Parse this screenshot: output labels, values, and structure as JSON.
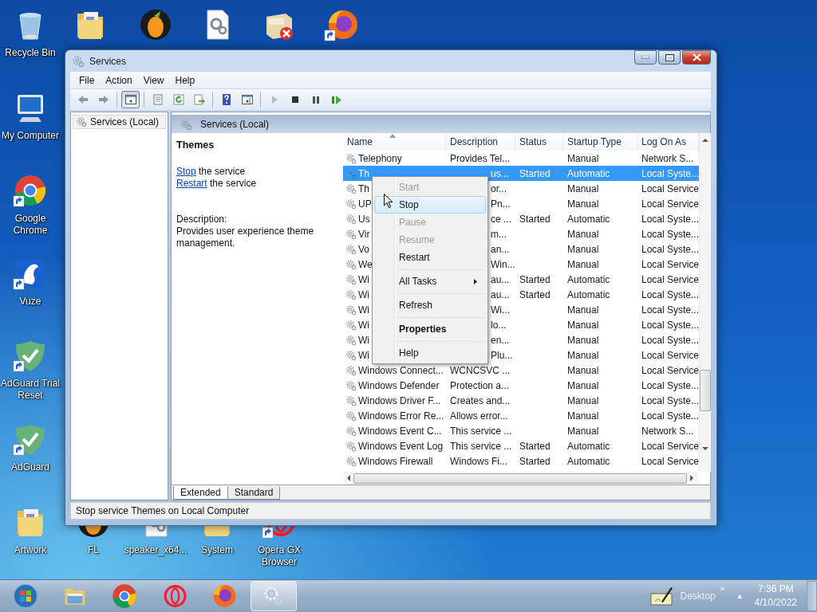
{
  "desktop_icons": [
    {
      "label": "Recycle Bin",
      "kind": "recycle",
      "shortcut": false
    },
    {
      "kind": "folder",
      "shortcut": false
    },
    {
      "kind": "fl",
      "shortcut": false
    },
    {
      "kind": "gearfile",
      "shortcut": false
    },
    {
      "kind": "nsis",
      "shortcut": false
    },
    {
      "kind": "firefox",
      "shortcut": true
    },
    {
      "label": "My Computer",
      "kind": "computer",
      "shortcut": false
    },
    {
      "label": "Google Chrome",
      "kind": "chrome",
      "shortcut": true
    },
    {
      "label": "Vuze",
      "kind": "vuze",
      "shortcut": true
    },
    {
      "label": "AdGuard Trial Reset",
      "kind": "adguard",
      "shortcut": true
    },
    {
      "label": "AdGuard",
      "kind": "adguard",
      "shortcut": true
    },
    {
      "label": "Artwork",
      "kind": "folder",
      "shortcut": false
    },
    {
      "label": "FL",
      "kind": "fl",
      "shortcut": false
    },
    {
      "label": "speaker_x64...",
      "kind": "gearfile",
      "shortcut": false
    },
    {
      "label": "System",
      "kind": "folder",
      "shortcut": false
    },
    {
      "label": "Opera GX Browser",
      "kind": "opera",
      "shortcut": true
    }
  ],
  "window": {
    "title": "Services",
    "menu": [
      "File",
      "Action",
      "View",
      "Help"
    ],
    "toolbar": [
      {
        "kind": "back",
        "disabled": false,
        "pressed": false
      },
      {
        "kind": "forward",
        "disabled": false,
        "pressed": false
      },
      {
        "kind": "separator"
      },
      {
        "kind": "tree",
        "disabled": false,
        "pressed": true
      },
      {
        "kind": "separator"
      },
      {
        "kind": "properties",
        "disabled": false,
        "pressed": false
      },
      {
        "kind": "refresh",
        "disabled": false,
        "pressed": false
      },
      {
        "kind": "export",
        "disabled": false,
        "pressed": false
      },
      {
        "kind": "separator"
      },
      {
        "kind": "help",
        "disabled": false,
        "pressed": false
      },
      {
        "kind": "actionpane",
        "disabled": false,
        "pressed": false
      },
      {
        "kind": "separator"
      },
      {
        "kind": "play",
        "disabled": true,
        "pressed": false
      },
      {
        "kind": "stop",
        "disabled": false,
        "pressed": false
      },
      {
        "kind": "pause",
        "disabled": false,
        "pressed": false
      },
      {
        "kind": "resume",
        "disabled": false,
        "pressed": false
      }
    ],
    "tree": [
      {
        "label": "Services (Local)",
        "selected": true
      }
    ],
    "pane_title": "Services (Local)",
    "details": {
      "service": "Themes",
      "actions": [
        {
          "link": "Stop",
          "text": "the service"
        },
        {
          "link": "Restart",
          "text": "the service"
        }
      ],
      "description_label": "Description:",
      "description": "Provides user experience theme management."
    },
    "table": {
      "columns": [
        {
          "label": "Name",
          "sorted": true
        },
        {
          "label": "Description",
          "sorted": false
        },
        {
          "label": "Status",
          "sorted": false
        },
        {
          "label": "Startup Type",
          "sorted": false
        },
        {
          "label": "Log On As",
          "sorted": false
        }
      ],
      "rows": [
        {
          "name": "Telephony",
          "description": "Provides Tel...",
          "startup": "Manual",
          "logon": "Network S...",
          "selected": false
        },
        {
          "name": "Th",
          "description": "us...",
          "status": "Started",
          "startup": "Automatic",
          "logon": "Local Syste...",
          "selected": true
        },
        {
          "name": "Th",
          "description": "or...",
          "startup": "Manual",
          "logon": "Local Service",
          "selected": false
        },
        {
          "name": "UP",
          "description": "Pn...",
          "startup": "Manual",
          "logon": "Local Service",
          "selected": false
        },
        {
          "name": "Us",
          "description": "ce ...",
          "status": "Started",
          "startup": "Automatic",
          "logon": "Local Syste...",
          "selected": false
        },
        {
          "name": "Vir",
          "description": "m...",
          "startup": "Manual",
          "logon": "Local Syste...",
          "selected": false
        },
        {
          "name": "Vo",
          "description": "an...",
          "startup": "Manual",
          "logon": "Local Syste...",
          "selected": false
        },
        {
          "name": "We",
          "description": "Win...",
          "startup": "Manual",
          "logon": "Local Service",
          "selected": false
        },
        {
          "name": "Wi",
          "description": "au...",
          "status": "Started",
          "startup": "Automatic",
          "logon": "Local Service",
          "selected": false
        },
        {
          "name": "Wi",
          "description": "au...",
          "status": "Started",
          "startup": "Automatic",
          "logon": "Local Syste...",
          "selected": false
        },
        {
          "name": "Wi",
          "description": "Wi...",
          "startup": "Manual",
          "logon": "Local Syste...",
          "selected": false
        },
        {
          "name": "Wi",
          "description": "lo...",
          "startup": "Manual",
          "logon": "Local Syste...",
          "selected": false
        },
        {
          "name": "Wi",
          "description": "en...",
          "startup": "Manual",
          "logon": "Local Syste...",
          "selected": false
        },
        {
          "name": "Wi",
          "description": "Plu...",
          "startup": "Manual",
          "logon": "Local Service",
          "selected": false
        },
        {
          "name": "Windows Connect...",
          "description": "WCNCSVC ...",
          "startup": "Manual",
          "logon": "Local Service",
          "selected": false
        },
        {
          "name": "Windows Defender",
          "description": "Protection a...",
          "startup": "Manual",
          "logon": "Local Syste...",
          "selected": false
        },
        {
          "name": "Windows Driver F...",
          "description": "Creates and...",
          "startup": "Manual",
          "logon": "Local Syste...",
          "selected": false
        },
        {
          "name": "Windows Error Re...",
          "description": "Allows error...",
          "startup": "Manual",
          "logon": "Local Syste...",
          "selected": false
        },
        {
          "name": "Windows Event C...",
          "description": "This service ...",
          "startup": "Manual",
          "logon": "Network S...",
          "selected": false
        },
        {
          "name": "Windows Event Log",
          "description": "This service ...",
          "status": "Started",
          "startup": "Automatic",
          "logon": "Local Service",
          "selected": false
        },
        {
          "name": "Windows Firewall",
          "description": "Windows Fi...",
          "status": "Started",
          "startup": "Automatic",
          "logon": "Local Service",
          "selected": false
        }
      ]
    },
    "view_tabs": [
      {
        "label": "Extended",
        "selected": true
      },
      {
        "label": "Standard",
        "selected": false
      }
    ],
    "status_bar": "Stop service Themes on Local Computer"
  },
  "context_menu": [
    {
      "kind": "item",
      "label": "Start",
      "disabled": true,
      "selected": false,
      "default": false
    },
    {
      "kind": "item",
      "label": "Stop",
      "disabled": false,
      "selected": true,
      "default": false
    },
    {
      "kind": "item",
      "label": "Pause",
      "disabled": true,
      "selected": false,
      "default": false
    },
    {
      "kind": "item",
      "label": "Resume",
      "disabled": true,
      "selected": false,
      "default": false
    },
    {
      "kind": "item",
      "label": "Restart",
      "disabled": false,
      "selected": false,
      "default": false
    },
    {
      "kind": "separator"
    },
    {
      "kind": "submenu",
      "label": "All Tasks",
      "disabled": false,
      "selected": false,
      "default": false
    },
    {
      "kind": "separator"
    },
    {
      "kind": "item",
      "label": "Refresh",
      "disabled": false,
      "selected": false,
      "default": false
    },
    {
      "kind": "separator"
    },
    {
      "kind": "item",
      "label": "Properties",
      "disabled": false,
      "selected": false,
      "default": true
    },
    {
      "kind": "separator"
    },
    {
      "kind": "item",
      "label": "Help",
      "disabled": false,
      "selected": false,
      "default": false
    }
  ],
  "taskbar": {
    "buttons": [
      {
        "kind": "start",
        "selected": false
      },
      {
        "kind": "explorer",
        "selected": false
      },
      {
        "kind": "chrome",
        "selected": false
      },
      {
        "kind": "opera",
        "selected": false
      },
      {
        "kind": "firefox",
        "selected": false
      },
      {
        "kind": "services",
        "selected": true
      }
    ],
    "toolbar_label": "Desktop",
    "chevron": "»",
    "notify_arrow": "▲",
    "time": "7:36 PM",
    "date": "4/10/2022"
  }
}
